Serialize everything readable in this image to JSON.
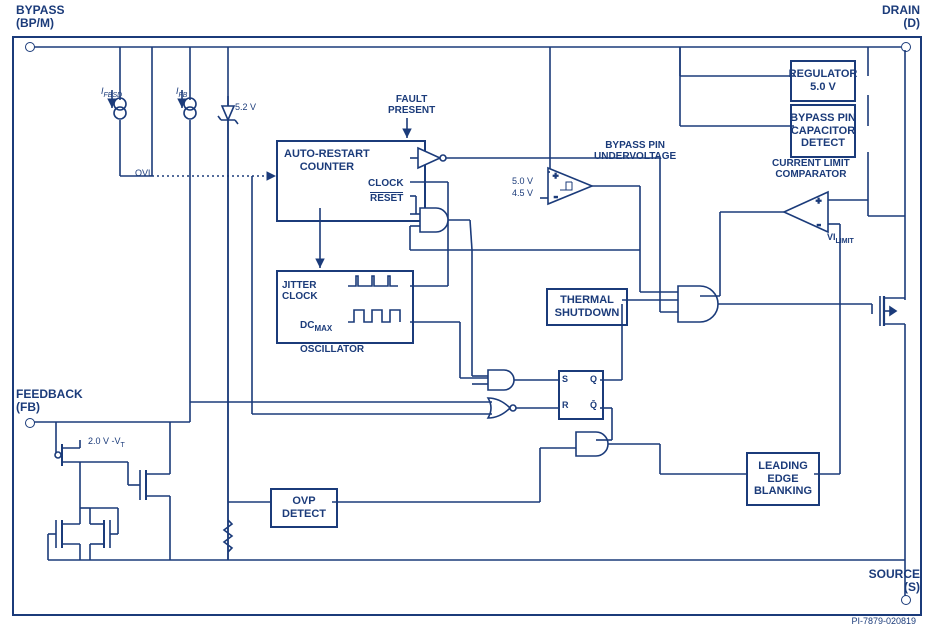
{
  "pins": {
    "bypass": {
      "main": "BYPASS",
      "sub": "(BP/M)"
    },
    "drain": {
      "main": "DRAIN",
      "sub": "(D)"
    },
    "feedback": {
      "main": "FEEDBACK",
      "sub": "(FB)"
    },
    "source": {
      "main": "SOURCE",
      "sub": "(S)"
    }
  },
  "zener": "5.2 V",
  "currents": {
    "ifbsd": "I",
    "ifbsd_sub": "FBSD",
    "ifb": "I",
    "ifb_sub": "FB"
  },
  "ovl": "OVL",
  "fb_threshold": "2.0 V -V",
  "fb_threshold_sub": "T",
  "fault_present": "FAULT\nPRESENT",
  "blocks": {
    "auto_restart": "AUTO-RESTART\nCOUNTER",
    "clock_lbl": "CLOCK",
    "reset_lbl": "RESET",
    "oscillator": "OSCILLATOR",
    "jitter": "JITTER\nCLOCK",
    "dcmax": "DC",
    "dcmax_sub": "MAX",
    "thermal": "THERMAL\nSHUTDOWN",
    "ovp": "OVP\nDETECT",
    "regulator": "REGULATOR\n5.0 V",
    "bypass_cap": "BYPASS PIN\nCAPACITOR\nDETECT",
    "bypass_uv": "BYPASS PIN\nUNDERVOLTAGE",
    "current_limit": "CURRENT LIMIT\nCOMPARATOR",
    "leading_edge": "LEADING\nEDGE\nBLANKING"
  },
  "comparator_refs": {
    "hi": "5.0 V",
    "lo": "4.5 V"
  },
  "vilimit": "VI",
  "vilimit_sub": "LIMIT",
  "sr": {
    "s": "S",
    "r": "R",
    "q": "Q",
    "qbar": "Q̄"
  },
  "doc_id": "PI-7879-020819"
}
